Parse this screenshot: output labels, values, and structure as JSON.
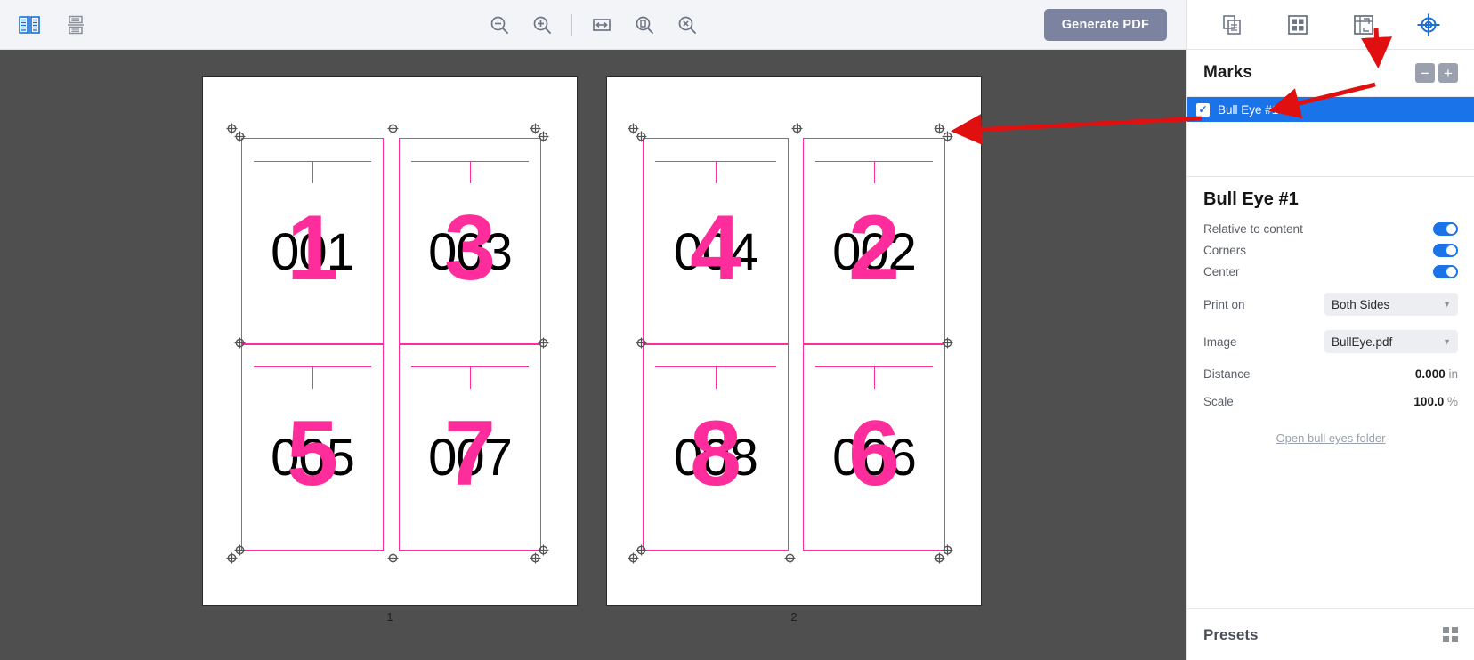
{
  "toolbar": {
    "left_icons": [
      {
        "name": "two-page-spread-icon",
        "active": true
      },
      {
        "name": "save-sheet-icon",
        "active": false
      }
    ],
    "center_icons": [
      {
        "name": "zoom-out-icon"
      },
      {
        "name": "zoom-in-icon"
      },
      {
        "name": "fit-width-icon"
      },
      {
        "name": "fit-page-icon"
      },
      {
        "name": "zoom-reset-icon"
      }
    ],
    "generate_pdf_label": "Generate PDF",
    "generate_pdf_color": "#7c83a0"
  },
  "canvas": {
    "mark_color": "#ff2d9b",
    "background": "#4f4f4f",
    "sheets": [
      {
        "page_label": "1",
        "cells": [
          {
            "black": "001",
            "pink": "1"
          },
          {
            "black": "003",
            "pink": "3"
          },
          {
            "black": "005",
            "pink": "5"
          },
          {
            "black": "007",
            "pink": "7"
          }
        ]
      },
      {
        "page_label": "2",
        "cells": [
          {
            "black": "004",
            "pink": "4"
          },
          {
            "black": "002",
            "pink": "2"
          },
          {
            "black": "008",
            "pink": "8"
          },
          {
            "black": "006",
            "pink": "6"
          }
        ]
      }
    ]
  },
  "sidebar": {
    "tabs": [
      {
        "name": "pages-tab",
        "active": false
      },
      {
        "name": "imposition-grid-tab",
        "active": false
      },
      {
        "name": "layout-flow-tab",
        "active": false
      },
      {
        "name": "marks-tab",
        "active": true
      }
    ],
    "marks": {
      "title": "Marks",
      "remove_label": "−",
      "add_label": "+",
      "items": [
        {
          "label": "Bull Eye #1",
          "checked": true,
          "selected": true
        }
      ],
      "selected_color": "#1a73e8"
    },
    "properties": {
      "title": "Bull Eye #1",
      "toggles": [
        {
          "label": "Relative to content",
          "on": true
        },
        {
          "label": "Corners",
          "on": true
        },
        {
          "label": "Center",
          "on": true
        }
      ],
      "selects": [
        {
          "label": "Print on",
          "value": "Both Sides"
        },
        {
          "label": "Image",
          "value": "BullEye.pdf"
        }
      ],
      "values": [
        {
          "label": "Distance",
          "value": "0.000",
          "unit": "in"
        },
        {
          "label": "Scale",
          "value": "100.0",
          "unit": "%"
        }
      ],
      "folder_link": "Open bull eyes folder"
    },
    "presets": {
      "title": "Presets"
    }
  },
  "annotations": {
    "arrow_color": "#e11010",
    "arrows": [
      {
        "name": "arrow-to-add-mark-button"
      },
      {
        "name": "arrow-to-mark-row"
      },
      {
        "name": "arrow-to-canvas-bullseye"
      }
    ]
  }
}
